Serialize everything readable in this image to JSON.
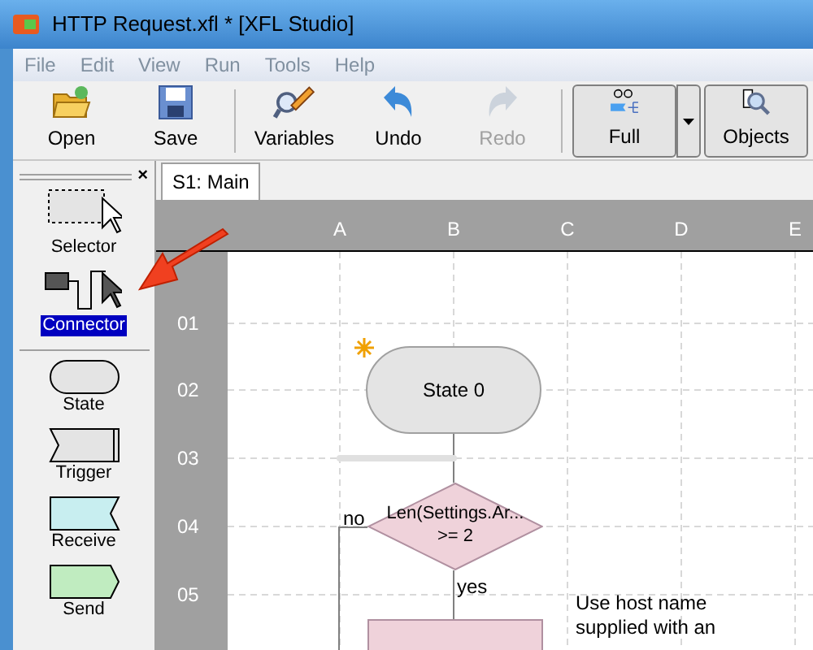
{
  "window": {
    "title": "HTTP Request.xfl * [XFL Studio]"
  },
  "menu": [
    "File",
    "Edit",
    "View",
    "Run",
    "Tools",
    "Help"
  ],
  "toolbar": [
    {
      "label": "Open",
      "kind": "open",
      "disabled": false
    },
    {
      "label": "Save",
      "kind": "save",
      "disabled": false
    },
    {
      "kind": "separator"
    },
    {
      "label": "Variables",
      "kind": "variables",
      "disabled": false
    },
    {
      "label": "Undo",
      "kind": "undo",
      "disabled": false
    },
    {
      "label": "Redo",
      "kind": "redo",
      "disabled": true
    },
    {
      "kind": "separator"
    },
    {
      "label": "Full",
      "kind": "full",
      "disabled": false
    },
    {
      "kind": "dropdown"
    },
    {
      "label": "Objects",
      "kind": "objects",
      "disabled": false
    }
  ],
  "palette": {
    "close": "×",
    "items": [
      {
        "label": "Selector",
        "kind": "selector",
        "selected": false
      },
      {
        "label": "Connector",
        "kind": "connector",
        "selected": true
      },
      {
        "kind": "separator"
      },
      {
        "label": "State",
        "kind": "state",
        "selected": false
      },
      {
        "label": "Trigger",
        "kind": "trigger",
        "selected": false
      },
      {
        "label": "Receive",
        "kind": "receive",
        "selected": false
      },
      {
        "label": "Send",
        "kind": "send",
        "selected": false
      }
    ]
  },
  "tabs": [
    {
      "label": "S1: Main",
      "selected": true
    }
  ],
  "canvas": {
    "columns": [
      "A",
      "B",
      "C",
      "D",
      "E"
    ],
    "rows": [
      "01",
      "02",
      "03",
      "04",
      "05"
    ],
    "nodes": [
      {
        "kind": "state",
        "label": "State 0",
        "initial": true
      },
      {
        "kind": "decision",
        "label": "Len(Settings.Ar...\n>= 2",
        "no": "no",
        "yes": "yes"
      },
      {
        "kind": "action"
      }
    ],
    "note": "Use host name\nsupplied with an"
  }
}
